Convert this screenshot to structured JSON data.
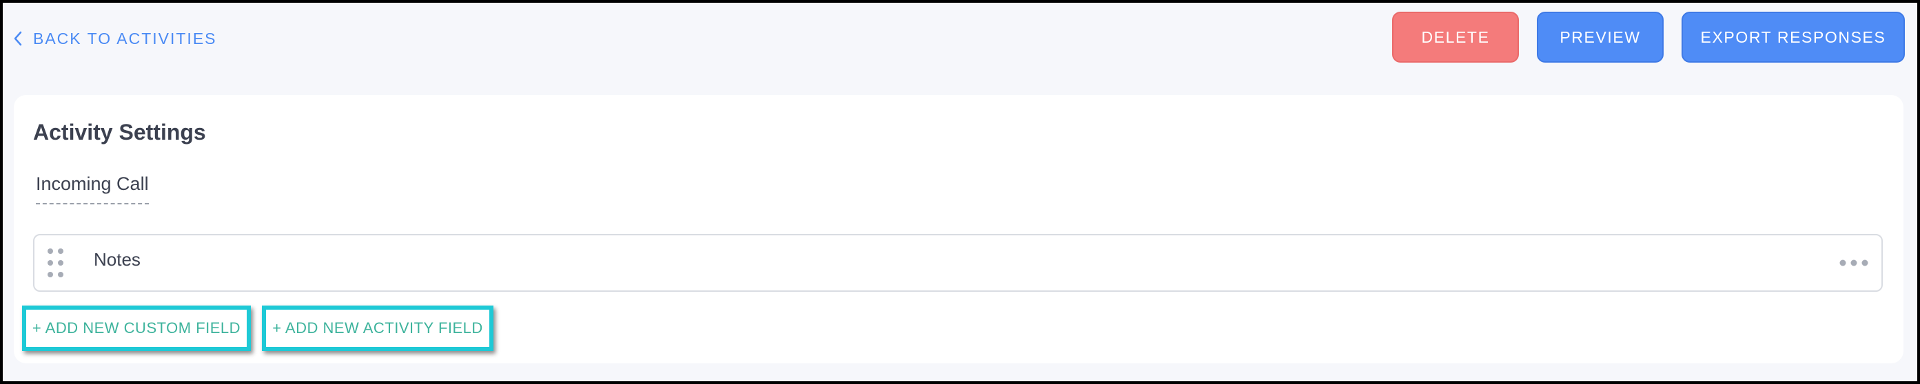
{
  "topbar": {
    "back_label": "BACK TO ACTIVITIES",
    "buttons": {
      "delete": "DELETE",
      "preview": "PREVIEW",
      "export": "EXPORT RESPONSES"
    }
  },
  "card": {
    "title": "Activity Settings",
    "activity_name": "Incoming Call",
    "fields": [
      {
        "label": "Notes"
      }
    ],
    "add_custom_field": "+ ADD NEW CUSTOM FIELD",
    "add_activity_field": "+ ADD NEW ACTIVITY FIELD"
  },
  "icons": {
    "back": "chevron-left-icon",
    "drag": "drag-handle-icon",
    "more": "more-horizontal-icon"
  },
  "colors": {
    "accent_blue": "#4f8cf6",
    "danger": "#f47b7b",
    "teal_text": "#3db39c",
    "highlight": "#1ec9d6",
    "background": "#f6f7fb"
  }
}
